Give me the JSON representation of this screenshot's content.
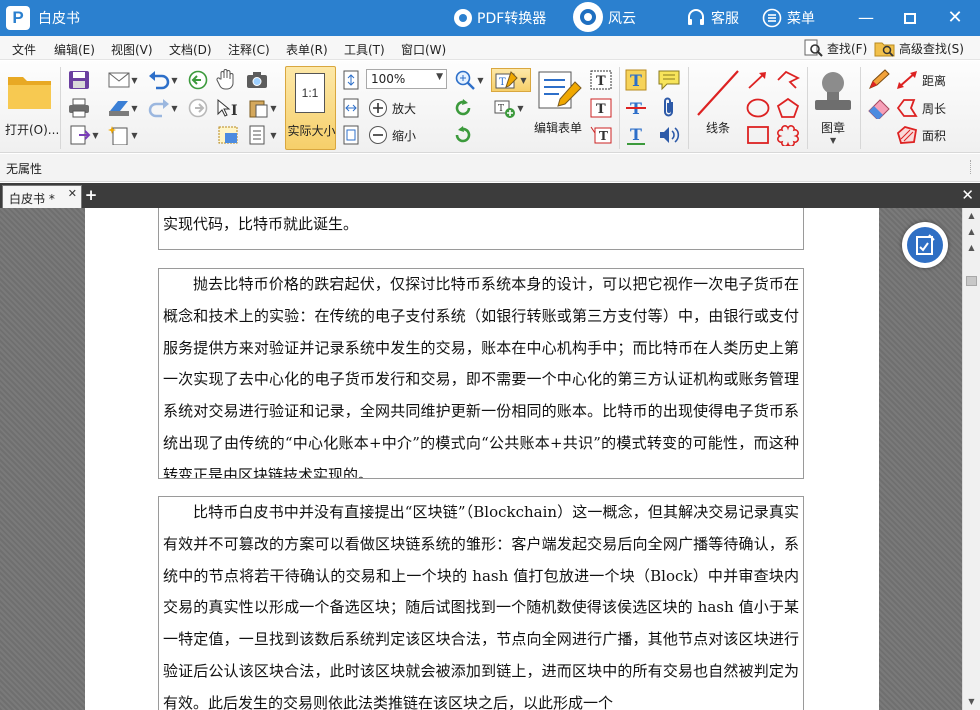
{
  "titlebar": {
    "app_title": "白皮书",
    "logo_letter": "P",
    "pdf_converter": "PDF转换器",
    "fengyun": "风云",
    "service": "客服",
    "menu": "菜单"
  },
  "menubar": {
    "items": [
      "文件",
      "编辑(E)",
      "视图(V)",
      "文档(D)",
      "注释(C)",
      "表单(R)",
      "工具(T)",
      "窗口(W)"
    ],
    "find": "查找(F)",
    "advanced_find": "高级查找(S)"
  },
  "toolbar": {
    "open_label": "打开(O)...",
    "actual_size_icon_text": "1:1",
    "actual_size_label": "实际大小",
    "zoom_value": "100%",
    "zoom_in_label": "放大",
    "zoom_out_label": "缩小",
    "edit_form_label": "编辑表单",
    "line_label": "线条",
    "stamp_label": "图章",
    "distance_label": "距离",
    "perimeter_label": "周长",
    "area_label": "面积"
  },
  "properties_bar": {
    "label": "无属性"
  },
  "tabs": [
    {
      "label": "白皮书 *"
    }
  ],
  "document": {
    "para1": "实现代码，比特币就此诞生。",
    "para2": "抛去比特币价格的跌宕起伏，仅探讨比特币系统本身的设计，可以把它视作一次电子货币在概念和技术上的实验：在传统的电子支付系统（如银行转账或第三方支付等）中，由银行或支付服务提供方来对验证并记录系统中发生的交易，账本在中心机构手中；而比特币在人类历史上第一次实现了去中心化的电子货币发行和交易，即不需要一个中心化的第三方认证机构或账务管理系统对交易进行验证和记录，全网共同维护更新一份相同的账本。比特币的出现使得电子货币系统出现了由传统的“中心化账本+中介”的模式向“公共账本+共识”的模式转变的可能性，而这种转变正是由区块链技术实现的。",
    "para3": "比特币白皮书中并没有直接提出“区块链”（Blockchain）这一概念，但其解决交易记录真实有效并不可篡改的方案可以看做区块链系统的雏形：客户端发起交易后向全网广播等待确认，系统中的节点将若干待确认的交易和上一个块的 hash 值打包放进一个块（Block）中并审查块内交易的真实性以形成一个备选区块；随后试图找到一个随机数使得该侯选区块的 hash 值小于某一特定值，一旦找到该数后系统判定该区块合法，节点向全网进行广播，其他节点对该区块进行验证后公认该区块合法，此时该区块就会被添加到链上，进而区块中的所有交易也自然被判定为有效。此后发生的交易则依此法类推链在该区块之后，以此形成一个"
  },
  "colors": {
    "titlebar_bg": "#2b80cf",
    "tab_bar_bg": "#3c3c3c",
    "doc_bg": "#737373",
    "accent_button": "#2f6fc4"
  },
  "icons": [
    "pdf-converter-icon",
    "fengyun-icon",
    "headset-icon",
    "menu-list-icon",
    "minimize-icon",
    "maximize-icon",
    "close-icon",
    "search-icon",
    "advanced-search-icon"
  ]
}
